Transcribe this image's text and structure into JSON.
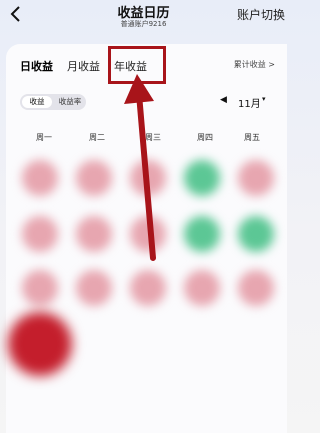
{
  "header": {
    "title": "收益日历",
    "subtitle": "普通账户9216",
    "switch_label": "账户切换"
  },
  "tabs": [
    {
      "label": "日收益",
      "active": true
    },
    {
      "label": "月收益",
      "active": false
    },
    {
      "label": "年收益",
      "active": false
    }
  ],
  "cumulative_link": "累计收益 >",
  "segmented": {
    "options": [
      "收益",
      "收益率"
    ],
    "selected": "收益"
  },
  "month": {
    "prev": "◀",
    "label": "11月",
    "dropdown": "▾"
  },
  "weekdays": [
    "周一",
    "周二",
    "周三",
    "周四",
    "周五"
  ],
  "calendar_cells": [
    {
      "col": 0,
      "row": 0,
      "color": "red"
    },
    {
      "col": 1,
      "row": 0,
      "color": "red"
    },
    {
      "col": 2,
      "row": 0,
      "color": "red"
    },
    {
      "col": 3,
      "row": 0,
      "color": "green"
    },
    {
      "col": 4,
      "row": 0,
      "color": "red"
    },
    {
      "col": 0,
      "row": 1,
      "color": "red"
    },
    {
      "col": 1,
      "row": 1,
      "color": "red"
    },
    {
      "col": 2,
      "row": 1,
      "color": "red"
    },
    {
      "col": 3,
      "row": 1,
      "color": "green"
    },
    {
      "col": 4,
      "row": 1,
      "color": "green"
    },
    {
      "col": 0,
      "row": 2,
      "color": "red"
    },
    {
      "col": 1,
      "row": 2,
      "color": "red"
    },
    {
      "col": 2,
      "row": 2,
      "color": "red"
    },
    {
      "col": 3,
      "row": 2,
      "color": "red"
    },
    {
      "col": 4,
      "row": 2,
      "color": "red"
    }
  ],
  "colors": {
    "red": "#e7a6b0",
    "green": "#5cc795",
    "highlight": "#a8141a"
  }
}
